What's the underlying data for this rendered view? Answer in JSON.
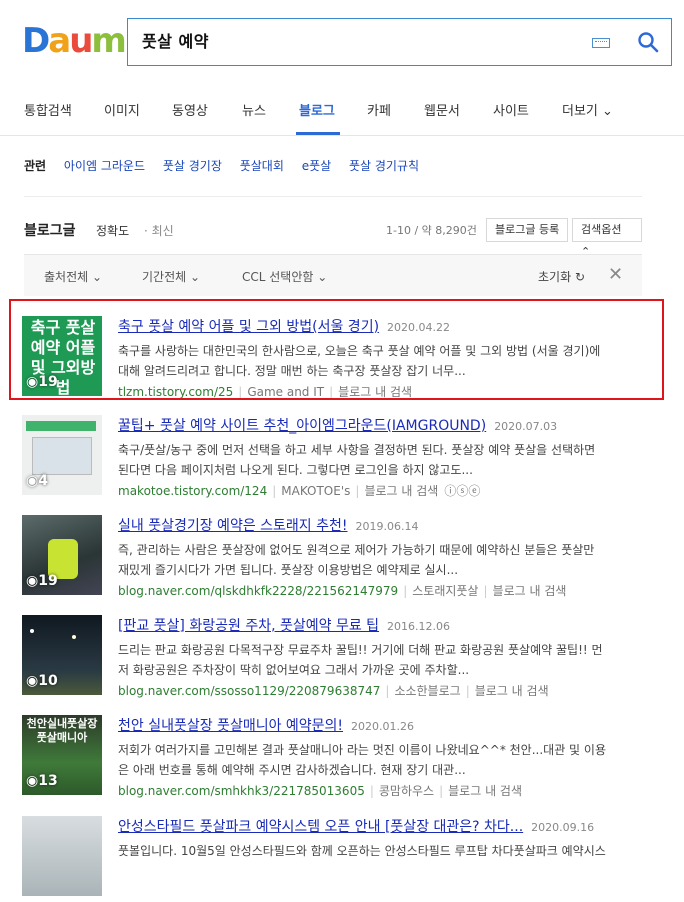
{
  "search": {
    "query": "풋살 예약"
  },
  "logo": {
    "text": "Daum"
  },
  "nav": [
    "통합검색",
    "이미지",
    "동영상",
    "뉴스",
    "블로그",
    "카페",
    "웹문서",
    "사이트",
    "더보기"
  ],
  "nav_active": "블로그",
  "related": {
    "title": "관련",
    "items": [
      "아이엠 그라운드",
      "풋살 경기장",
      "풋살대회",
      "e풋살",
      "풋살 경기규칙"
    ]
  },
  "blog_header": {
    "title": "블로그글",
    "sort_accuracy": "정확도",
    "sort_recent": "· 최신",
    "count": "1-10 / 약 8,290건",
    "register_btn": "블로그글 등록",
    "options_btn": "검색옵션 ⌃"
  },
  "filters": {
    "source": "출처전체",
    "period": "기간전체",
    "ccl": "CCL 선택안함",
    "reset": "초기화"
  },
  "results": [
    {
      "title": "축구 풋살 예약 어플 및 그외 방법(서울 경기)",
      "date": "2020.04.22",
      "desc1": "축구를 사랑하는 대한민국의 한사람으로, 오늘은 축구 풋살 예약 어플 및 그외 방법 (서울 경기)에",
      "desc2": "대해 알려드리려고 합니다. 정말 매번 하는 축구장 풋살장 잡기 너무...",
      "url": "tlzm.tistory.com/25",
      "author": "Game and IT",
      "blog_search": "블로그 내 검색",
      "thumb_count": "19",
      "thumb_text": "축구 풋살 예약 어플 및 그외방법"
    },
    {
      "title": "꿀팁+ 풋살 예약 사이트 추천_아이엠그라운드(IAMGROUND)",
      "date": "2020.07.03",
      "desc1": "축구/풋살/농구 중에 먼저 선택을 하고 세부 사항을 결정하면 된다. 풋살장 예약 풋살을 선택하면",
      "desc2": "된다면 다음 페이지처럼 나오게 된다. 그렇다면 로그인을 하지 않고도...",
      "url": "makotoe.tistory.com/124",
      "author": "MAKOTOE's",
      "blog_search": "블로그 내 검색",
      "thumb_count": "4"
    },
    {
      "title": "실내 풋살경기장 예약은 스토래지 추천!",
      "date": "2019.06.14",
      "desc1": "즉, 관리하는 사람은 풋살장에 없어도 원격으로 제어가 가능하기 때문에 예약하신 분들은 풋살만",
      "desc2": "재밌게 즐기시다가 가면 됩니다. 풋살장 이용방법은 예약제로 실시...",
      "url": "blog.naver.com/qlskdhkfk2228/221562147979",
      "author": "스토래지풋살",
      "blog_search": "블로그 내 검색",
      "thumb_count": "19"
    },
    {
      "title": "[판교 풋살] 화랑공원 주차, 풋살예약 무료 팁",
      "date": "2016.12.06",
      "desc1": "드리는 판교 화랑공원 다목적구장 무료주차 꿀팁!! 거기에 더해 판교 화랑공원 풋살예약 꿀팁!! 먼",
      "desc2": "저 화랑공원은 주차장이 딱히 없어보여요 그래서 가까운 곳에 주차할...",
      "url": "blog.naver.com/ssosso1129/220879638747",
      "author": "소소한블로그",
      "blog_search": "블로그 내 검색",
      "thumb_count": "10"
    },
    {
      "title": "천안 실내풋살장 풋살매니아 예약문의!",
      "date": "2020.01.26",
      "desc1": "저회가 여러가지를 고민해본 결과 풋살매니아 라는 멋진 이름이 나왔네요^^* 천안...대관 및 이용",
      "desc2": "은 아래 번호를 통해 예약해 주시면 감사하겠습니다. 현재 장기 대관...",
      "url": "blog.naver.com/smhkhk3/221785013605",
      "author": "콩맘하우스",
      "blog_search": "블로그 내 검색",
      "thumb_count": "13",
      "thumb_text": "천안실내풋살장 풋살매니아"
    },
    {
      "title": "안성스타필드 풋살파크 예약시스템 오픈 안내 [풋살장 대관은? 차다...",
      "date": "2020.09.16",
      "desc1": "풋볼입니다. 10월5일 안성스타필드와 함께 오픈하는 안성스타필드 루프탑 차다풋살파크 예약시스",
      "desc2": "",
      "url": "",
      "author": "",
      "blog_search": "",
      "thumb_count": ""
    }
  ],
  "colors": {
    "accent": "#2e6ad6",
    "link": "#1a2bb8",
    "url": "#2e7d32",
    "highlight": "#e0141b"
  }
}
